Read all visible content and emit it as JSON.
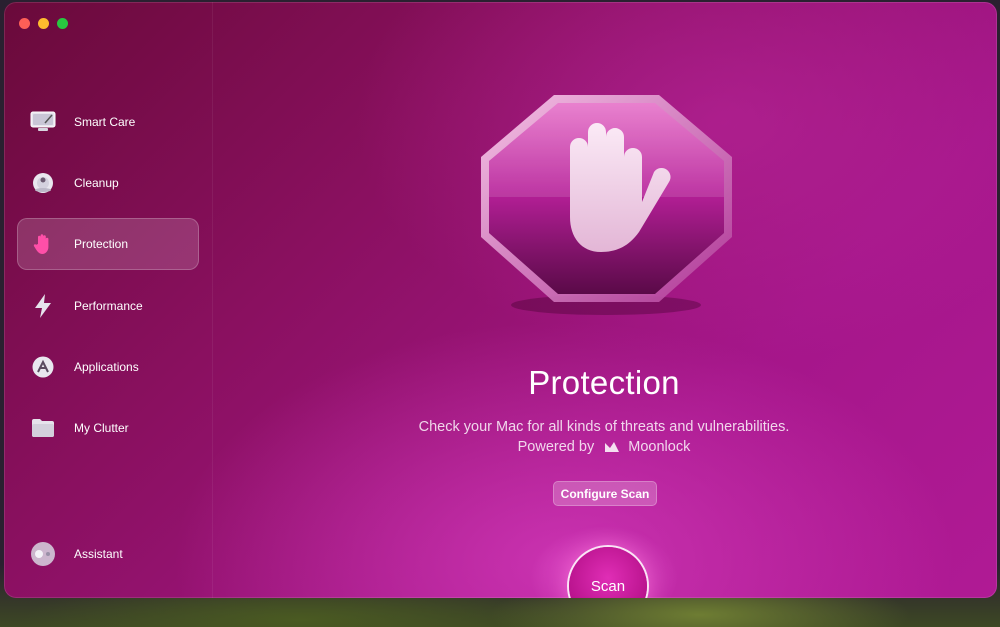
{
  "window": {
    "traffic_lights": [
      "close",
      "minimize",
      "zoom"
    ]
  },
  "sidebar": {
    "items": [
      {
        "label": "Smart Care",
        "icon": "monitor-icon"
      },
      {
        "label": "Cleanup",
        "icon": "disc-icon"
      },
      {
        "label": "Protection",
        "icon": "hand-icon",
        "active": true
      },
      {
        "label": "Performance",
        "icon": "lightning-icon"
      },
      {
        "label": "Applications",
        "icon": "apps-icon"
      },
      {
        "label": "My Clutter",
        "icon": "folder-icon"
      }
    ],
    "assistant": {
      "label": "Assistant",
      "icon": "assistant-toggle-icon"
    }
  },
  "main": {
    "hero_icon": "hand-stop-octagon-icon",
    "title": "Protection",
    "subtitle": "Check your Mac for all kinds of threats and vulnerabilities.",
    "powered_prefix": "Powered by",
    "powered_brand": "Moonlock",
    "configure_label": "Configure Scan",
    "scan_label": "Scan"
  },
  "colors": {
    "accent": "#b8128c",
    "window_gradient_start": "#6a0a3a",
    "window_gradient_end": "#b01a95"
  }
}
